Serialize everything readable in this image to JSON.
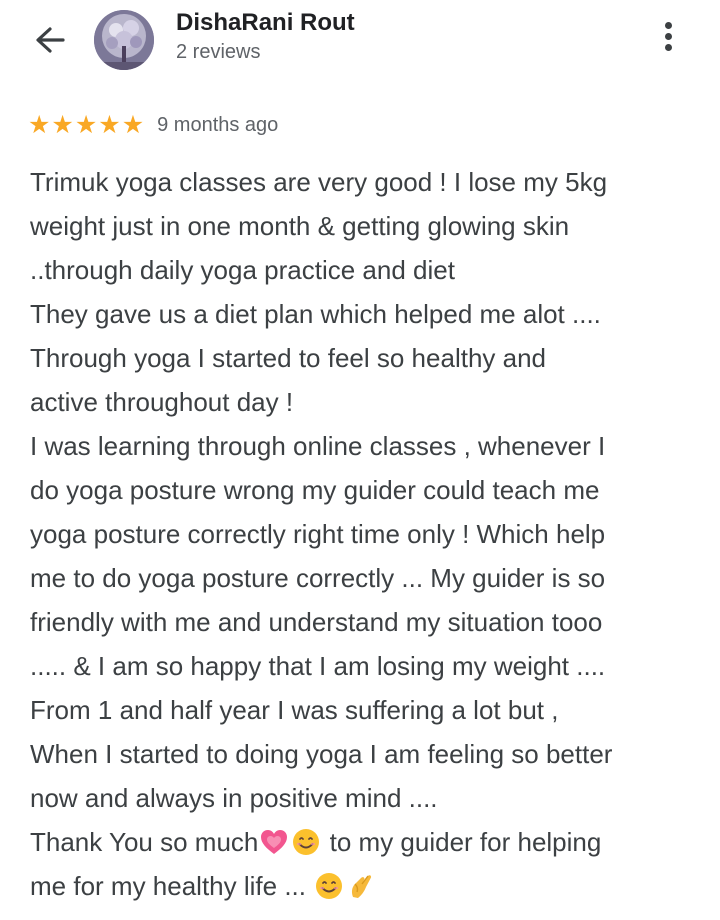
{
  "header": {
    "back_icon": "arrow-back-icon",
    "reviewer_name": "DishaRani Rout",
    "review_count": "2 reviews",
    "more_icon": "more-vert-icon"
  },
  "review": {
    "rating": 5,
    "rating_max": 5,
    "star_color": "#f9a825",
    "time_ago": "9 months ago",
    "lines": [
      "Trimuk yoga classes are very good ! I lose my 5kg",
      "weight just in one month & getting glowing skin",
      "..through daily yoga practice and diet",
      "They gave us a diet plan which helped me alot ....",
      "Through yoga I started to feel so healthy and",
      "active throughout day !",
      "I was learning through online classes , whenever I",
      "do yoga posture wrong my guider could teach me",
      "yoga posture correctly right time only ! Which help",
      "me to do yoga posture correctly ... My guider is so",
      "friendly with me and understand my situation tooo",
      "..... & I am so happy that I am losing my weight ....",
      "From 1 and half year I was suffering a lot but ,",
      "When I started to doing yoga I am feeling so better",
      "now and always in positive mind ....",
      "Thank You so much",
      "to my guider for helping",
      "me for my healthy life ..."
    ],
    "emojis": [
      "growing-heart-emoji",
      "smiling-face-emoji",
      "smiling-face-emoji",
      "pinching-hand-emoji"
    ]
  }
}
